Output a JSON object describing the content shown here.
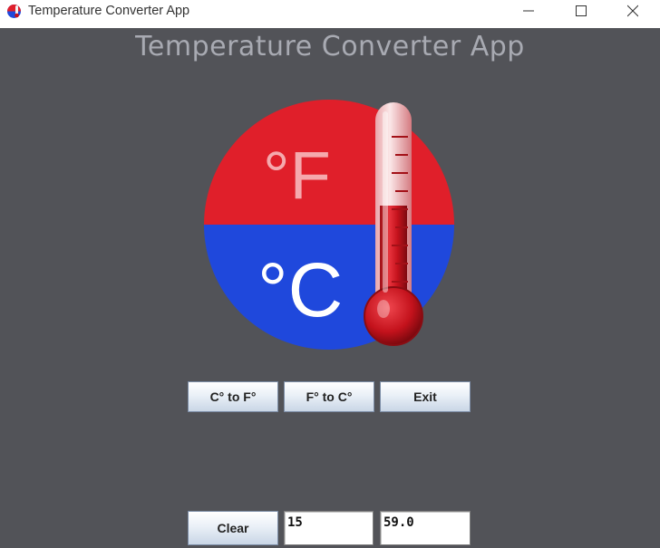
{
  "window": {
    "title": "Temperature Converter App"
  },
  "heading": "Temperature Converter App",
  "logo": {
    "icon": "thermometer-fahrenheit-celsius-logo",
    "fahrenheit_label": "°F",
    "celsius_label": "°C",
    "colors": {
      "top_red": "#e01f2a",
      "bottom_blue": "#1f48dc",
      "background": "#525358"
    }
  },
  "buttons": {
    "c_to_f": "C° to F°",
    "f_to_c": "F° to C°",
    "exit": "Exit",
    "clear": "Clear"
  },
  "fields": {
    "input_value": "15",
    "output_value": "59.0"
  }
}
